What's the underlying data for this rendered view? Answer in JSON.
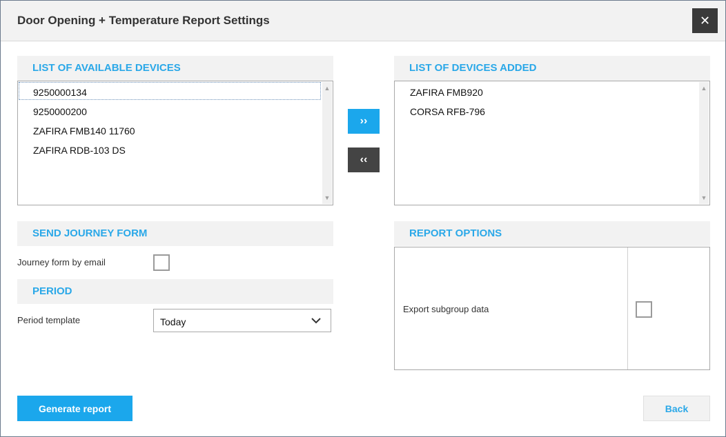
{
  "dialog": {
    "title": "Door Opening + Temperature Report Settings",
    "close_icon": "close-icon"
  },
  "available": {
    "heading": "LIST OF AVAILABLE DEVICES",
    "items": [
      "9250000134",
      "9250000200",
      "ZAFIRA FMB140 11760",
      "ZAFIRA RDB-103 DS"
    ]
  },
  "added": {
    "heading": "LIST OF DEVICES ADDED",
    "items": [
      "ZAFIRA FMB920",
      "CORSA RFB-796"
    ]
  },
  "transfer": {
    "add_glyph": "››",
    "remove_glyph": "‹‹"
  },
  "journey": {
    "heading": "SEND JOURNEY FORM",
    "email_label": "Journey form by email",
    "email_checked": false
  },
  "period": {
    "heading": "PERIOD",
    "template_label": "Period template",
    "template_value": "Today"
  },
  "report_options": {
    "heading": "REPORT OPTIONS",
    "subgroup_label": "Export subgroup data",
    "subgroup_checked": false
  },
  "footer": {
    "generate_label": "Generate report",
    "back_label": "Back"
  },
  "colors": {
    "accent": "#1ba7ec",
    "heading": "#2aa8e8",
    "dark_button": "#444444"
  }
}
